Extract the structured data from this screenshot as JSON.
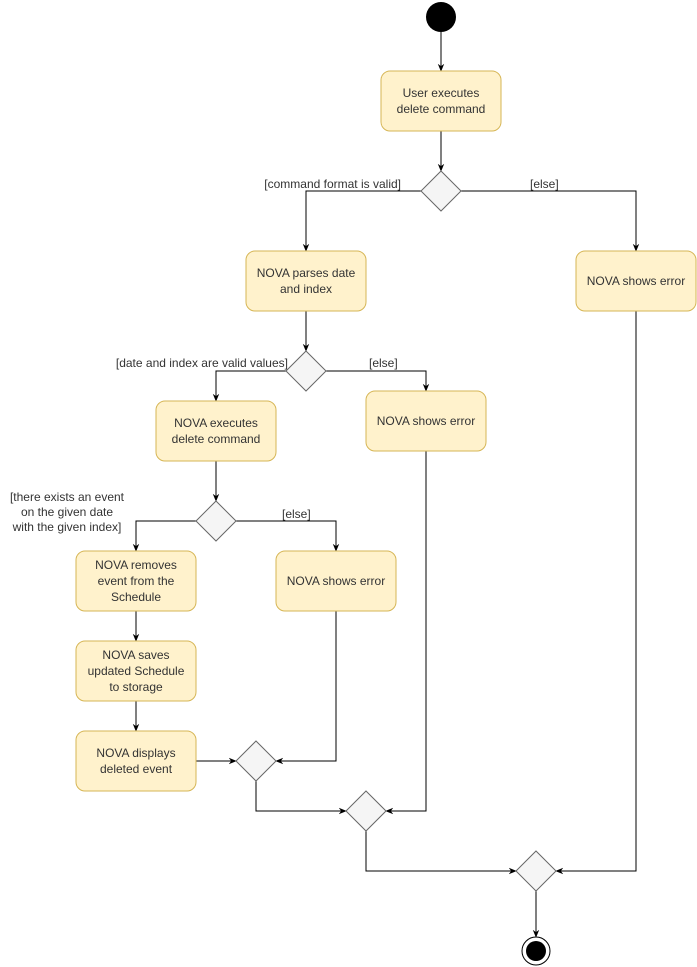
{
  "colors": {
    "action_fill": "#fff2cc",
    "action_stroke": "#d6b656",
    "decision_fill": "#f5f5f5",
    "decision_stroke": "#666666",
    "line": "#000000"
  },
  "nodes": {
    "start": {
      "kind": "initial"
    },
    "user_executes": {
      "kind": "action",
      "label": [
        "User executes",
        "delete command"
      ]
    },
    "d_format": {
      "kind": "decision"
    },
    "parses": {
      "kind": "action",
      "label": [
        "NOVA parses date",
        "and index"
      ]
    },
    "error_format": {
      "kind": "action",
      "label": [
        "NOVA shows error"
      ]
    },
    "d_values": {
      "kind": "decision"
    },
    "executes": {
      "kind": "action",
      "label": [
        "NOVA executes",
        "delete command"
      ]
    },
    "error_values": {
      "kind": "action",
      "label": [
        "NOVA shows error"
      ]
    },
    "d_exists": {
      "kind": "decision"
    },
    "removes": {
      "kind": "action",
      "label": [
        "NOVA removes",
        "event from the",
        "Schedule"
      ]
    },
    "error_exists": {
      "kind": "action",
      "label": [
        "NOVA shows error"
      ]
    },
    "saves": {
      "kind": "action",
      "label": [
        "NOVA saves",
        "updated Schedule",
        "to storage"
      ]
    },
    "displays": {
      "kind": "action",
      "label": [
        "NOVA displays",
        "deleted event"
      ]
    },
    "m1": {
      "kind": "merge"
    },
    "m2": {
      "kind": "merge"
    },
    "m3": {
      "kind": "merge"
    },
    "end": {
      "kind": "final"
    }
  },
  "guards": {
    "format_valid": [
      "[command format is valid]"
    ],
    "format_else": [
      "[else]"
    ],
    "values_valid": [
      "[date and index are valid values]"
    ],
    "values_else": [
      "[else]"
    ],
    "exists": [
      "[there exists an event",
      "on the given date",
      "with the given index]"
    ],
    "exists_else": [
      "[else]"
    ]
  }
}
